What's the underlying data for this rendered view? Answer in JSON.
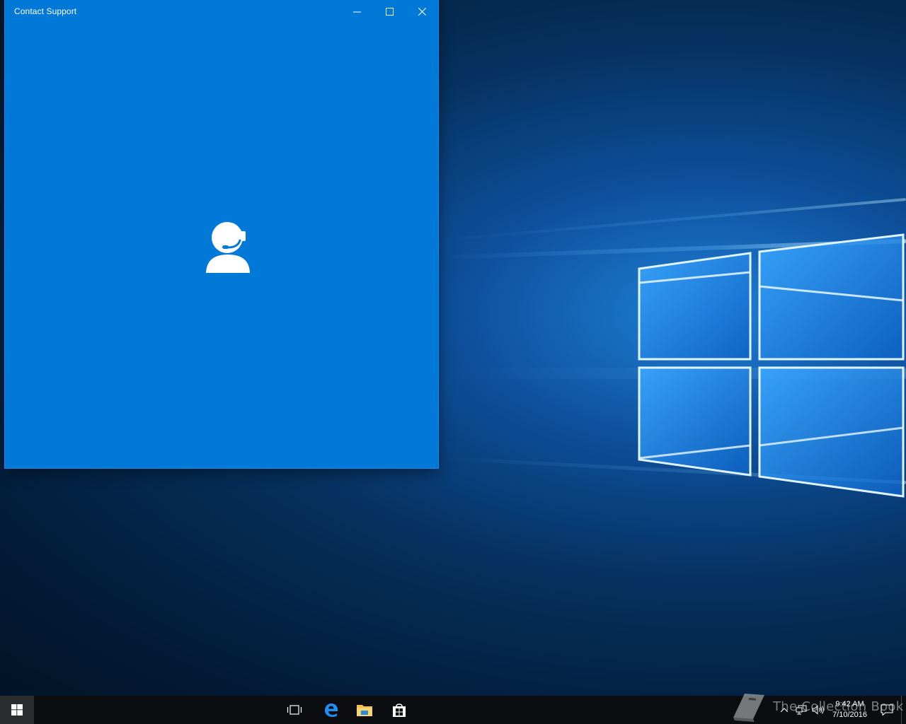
{
  "window": {
    "title": "Contact Support",
    "accent_color": "#0078d7",
    "controls": {
      "minimize_icon": "minimize-icon",
      "maximize_icon": "maximize-icon",
      "close_icon": "close-icon"
    },
    "center_icon": "headset-person-icon"
  },
  "taskbar": {
    "start_icon": "windows-logo-icon",
    "pinned": [
      {
        "icon": "task-view-icon"
      },
      {
        "icon": "edge-browser-icon"
      },
      {
        "icon": "file-explorer-icon"
      },
      {
        "icon": "store-icon"
      }
    ],
    "tray": {
      "icons": [
        "chevron-up-icon",
        "network-icon",
        "volume-icon"
      ],
      "time": "9:42 AM",
      "date": "7/10/2016",
      "notification_icon": "action-center-icon"
    }
  },
  "watermark": {
    "text": "The Collection Book",
    "icon": "book-icon"
  }
}
